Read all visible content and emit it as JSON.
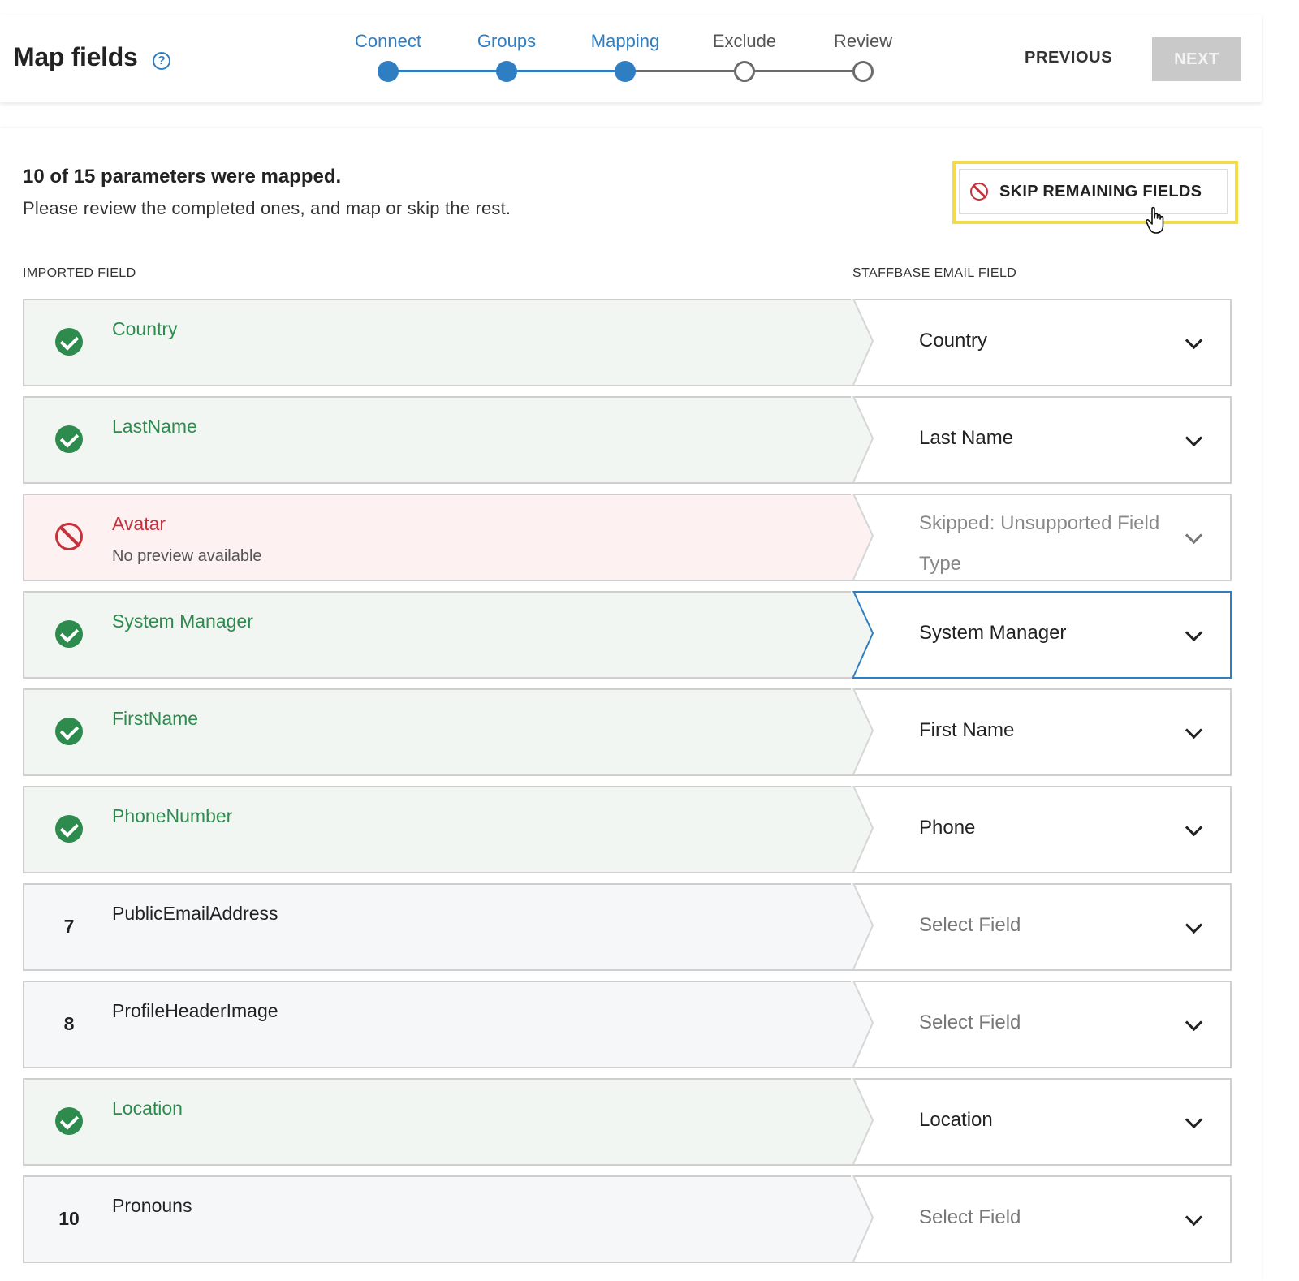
{
  "header": {
    "title": "Map fields",
    "help_icon": "question-circle-icon",
    "steps": [
      {
        "label": "Connect",
        "state": "done"
      },
      {
        "label": "Groups",
        "state": "done"
      },
      {
        "label": "Mapping",
        "state": "done"
      },
      {
        "label": "Exclude",
        "state": "todo"
      },
      {
        "label": "Review",
        "state": "todo"
      }
    ],
    "previous_label": "PREVIOUS",
    "next_label": "NEXT"
  },
  "summary": {
    "title": "10 of 15 parameters were mapped.",
    "subtitle": "Please review the completed ones, and map or skip the rest.",
    "skip_button_label": "SKIP REMAINING FIELDS"
  },
  "columns": {
    "imported": "IMPORTED FIELD",
    "staffbase": "STAFFBASE EMAIL FIELD"
  },
  "rows": [
    {
      "status": "mapped",
      "name": "Country",
      "value": "Country"
    },
    {
      "status": "mapped",
      "name": "LastName",
      "value": "Last Name"
    },
    {
      "status": "skipped",
      "name": "Avatar",
      "sub": "No preview available",
      "value": "Skipped: Unsupported Field Type"
    },
    {
      "status": "mapped",
      "name": "System Manager",
      "value": "System Manager",
      "selected": true
    },
    {
      "status": "mapped",
      "name": "FirstName",
      "value": "First Name"
    },
    {
      "status": "mapped",
      "name": "PhoneNumber",
      "value": "Phone"
    },
    {
      "status": "pending",
      "number": "7",
      "name": "PublicEmailAddress",
      "value": "Select Field"
    },
    {
      "status": "pending",
      "number": "8",
      "name": "ProfileHeaderImage",
      "value": "Select Field"
    },
    {
      "status": "mapped",
      "name": "Location",
      "value": "Location"
    },
    {
      "status": "pending",
      "number": "10",
      "name": "Pronouns",
      "value": "Select Field"
    }
  ],
  "colors": {
    "accent": "#2f7ec1",
    "mapped": "#2e8b4e",
    "skipped": "#c8303a",
    "highlight": "#f2dc49"
  }
}
